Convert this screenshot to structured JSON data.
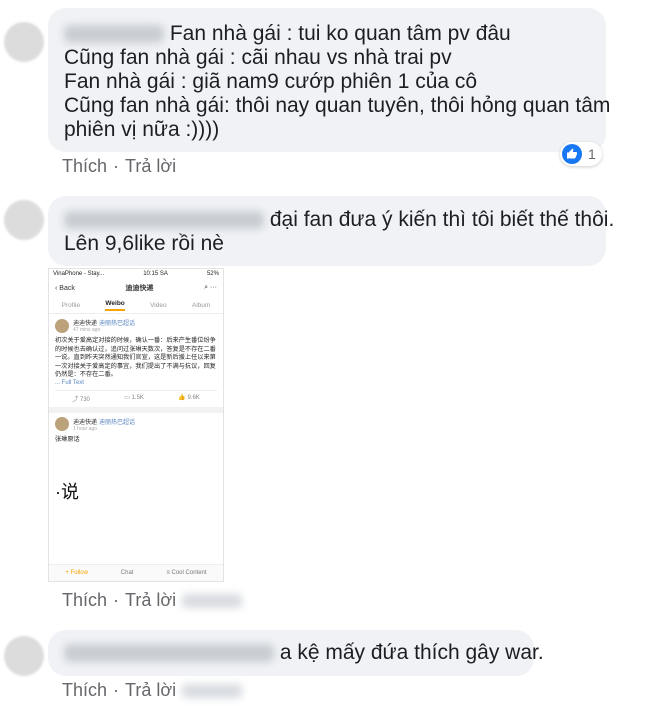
{
  "comments": [
    {
      "lines": [
        "Fan nhà gái : tui ko quan tâm pv đâu",
        "Cũng fan nhà gái : cãi nhau vs nhà trai pv",
        "Fan nhà gái : giã nam9 cướp phiên 1 của cô",
        "Cũng fan nhà gái: thôi nay quan tuyên, thôi hỏng quan tâm",
        "phiên vị nữa :))))"
      ],
      "like_label": "Thích",
      "reply_label": "Trả lời",
      "reaction_count": "1"
    },
    {
      "lines": [
        "đại fan đưa ý kiến thì tôi biết thế thôi.",
        "Lên 9,6like rồi nè"
      ],
      "like_label": "Thích",
      "reply_label": "Trả lời"
    },
    {
      "lines": [
        "a kệ mấy đứa thích gây war."
      ],
      "like_label": "Thích",
      "reply_label": "Trả lời"
    }
  ],
  "phone": {
    "carrier": "VinaPhone - Stay...",
    "clock": "10:15 SA",
    "battery": "52%",
    "back": "Back",
    "title": "迪迪快递",
    "tabs": [
      "Profile",
      "Weibo",
      "Video",
      "Album"
    ],
    "post1": {
      "user": "迪迪快递",
      "tag": "迪丽热巴超话",
      "time": "47 mins ago",
      "text": "初次关于爱高定对接的时候，确认一番：后来产生番位纷争的时候也去确认过，追问过张琳天数次，答复是不存在二番一说。直到昨天突然通知我们官宣，这是新后援上任以来第一次对接关于爱高定的事宜，我们提出了不满与抗议，回复仍然是：不存在二番。",
      "full_text": "... Full Text",
      "reposts": "730",
      "comments": "1.5K",
      "likes": "9.6K"
    },
    "post2": {
      "user": "迪迪快递",
      "tag": "迪丽热巴超话",
      "time": "1 hour ago",
      "text": "张琳原话",
      "big_text": "·说"
    },
    "bottom": [
      "+ Follow",
      "Chat",
      "≡ Cool Content"
    ]
  },
  "colors": {
    "bubble": "#f0f2f5",
    "action_text": "#65676b",
    "like_blue": "#1877f2",
    "weibo_orange": "#f7a400"
  }
}
